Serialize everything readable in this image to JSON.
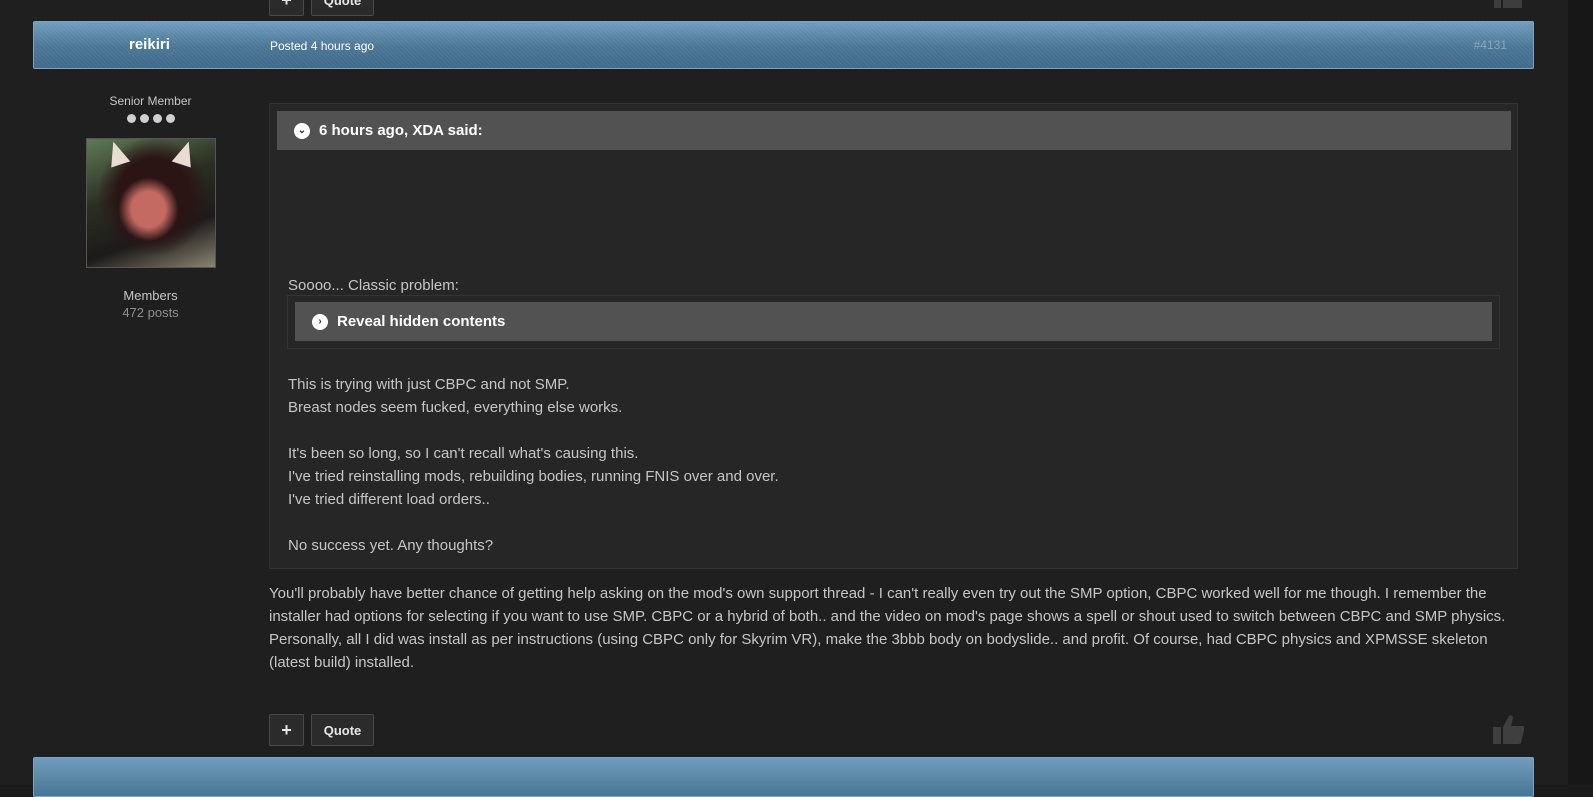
{
  "prev_post": {
    "plus_label": "+",
    "quote_label": "Quote",
    "like_icon": "thumbs-up-icon"
  },
  "post": {
    "author": "reikiri",
    "posted": "Posted 4 hours ago",
    "post_number": "#4131",
    "rank": "Senior Member",
    "group": "Members",
    "post_count": "472 posts",
    "quote": {
      "header": "6 hours ago, XDA said:",
      "intro": "Soooo... Classic problem:",
      "spoiler_label": "Reveal hidden contents",
      "lines": [
        "This is trying with just CBPC and not SMP.",
        "Breast nodes seem fucked, everything else works.",
        "",
        "It's been so long, so I can't recall what's causing this.",
        "I've tried reinstalling mods, rebuilding bodies, running FNIS over and over.",
        "I've tried different load orders..",
        "",
        "No success yet. Any thoughts?"
      ]
    },
    "body": "You'll probably have better chance of getting help asking on the mod's own support thread - I can't really even try out the SMP option, CBPC worked well for me though. I remember the installer had options for selecting if you want to use SMP. CBPC or a hybrid of both.. and the video on mod's page shows a spell or shout used to switch between CBPC and SMP physics. Personally, all I did was install as per instructions (using CBPC only for Skyrim VR), make the 3bbb body on bodyslide.. and profit. Of course, had CBPC physics and XPMSSE skeleton (latest build) installed.",
    "plus_label": "+",
    "quote_label": "Quote"
  },
  "colors": {
    "header_blue": "#4a7694",
    "background": "#1f1f1f",
    "quote_head": "#525252"
  }
}
